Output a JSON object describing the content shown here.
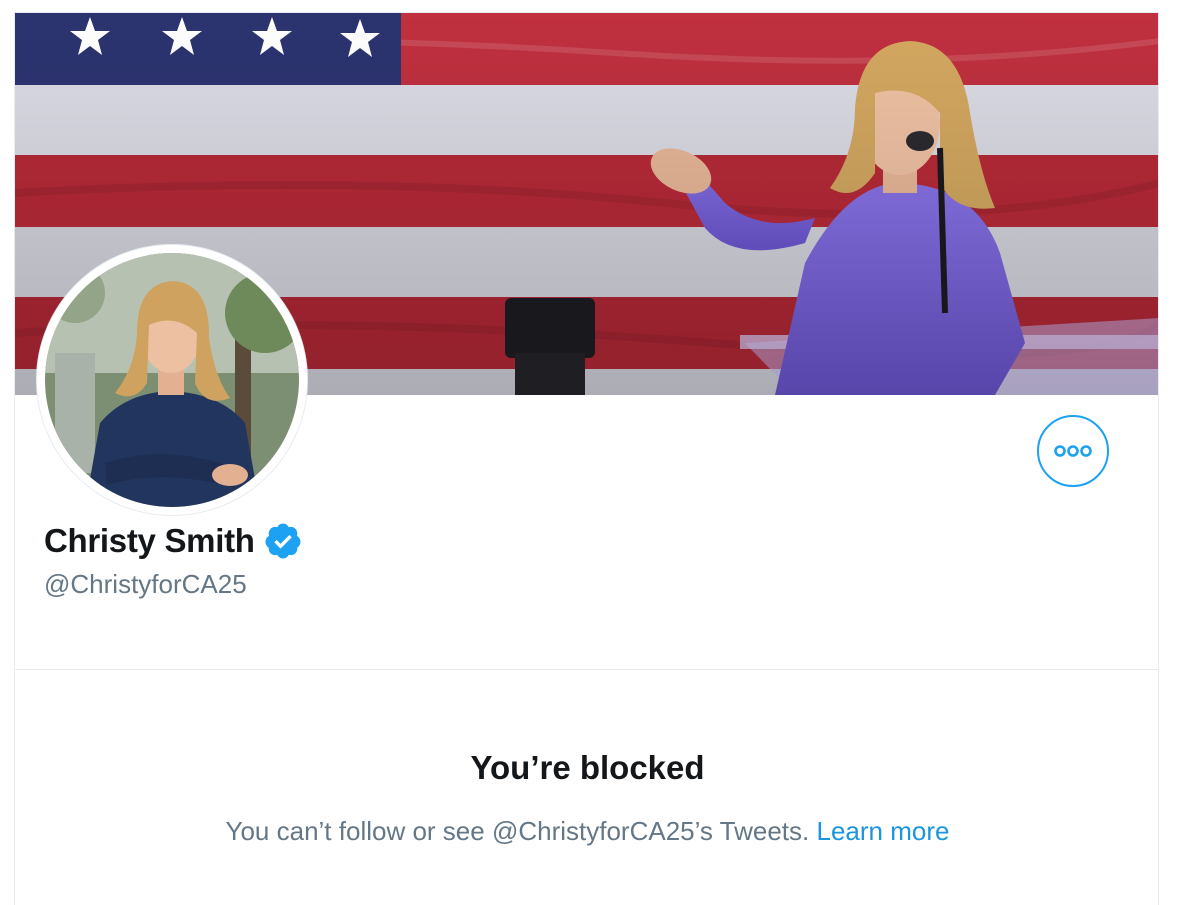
{
  "profile": {
    "display_name": "Christy Smith",
    "handle": "@ChristyforCA25",
    "verified": true
  },
  "blocked": {
    "title": "You’re blocked",
    "message": "You can’t follow or see @ChristyforCA25’s Tweets.",
    "learn_more": "Learn more"
  },
  "icons": {
    "more": "more-options-icon",
    "verified": "verified-badge-icon"
  },
  "colors": {
    "accent": "#1da1f2",
    "link": "#1b95e0",
    "text_primary": "#14171a",
    "text_secondary": "#657786",
    "border": "#e6ecf0"
  }
}
